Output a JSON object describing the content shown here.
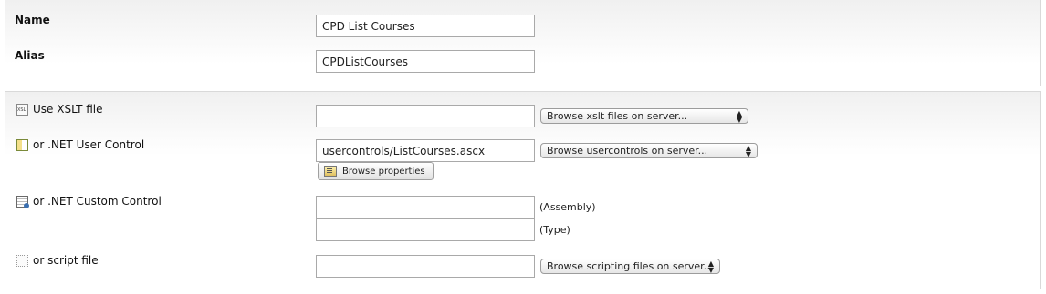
{
  "top": {
    "name_label": "Name",
    "name_value": "CPD List Courses",
    "alias_label": "Alias",
    "alias_value": "CPDListCourses"
  },
  "bottom": {
    "xslt": {
      "label": "Use XSLT file",
      "value": "",
      "select": "Browse xslt files on server...",
      "icon": "xslt-file-icon"
    },
    "user_control": {
      "label": "or .NET User Control",
      "value": "usercontrols/ListCourses.ascx",
      "select": "Browse usercontrols on server...",
      "button": "Browse properties",
      "icon": "user-control-icon"
    },
    "custom_control": {
      "label": "or .NET Custom Control",
      "assembly_value": "",
      "assembly_suffix": "(Assembly)",
      "type_value": "",
      "type_suffix": "(Type)",
      "icon": "custom-control-icon"
    },
    "script": {
      "label": "or script file",
      "value": "",
      "select": "Browse scripting files on server...",
      "icon": "script-file-icon"
    }
  }
}
